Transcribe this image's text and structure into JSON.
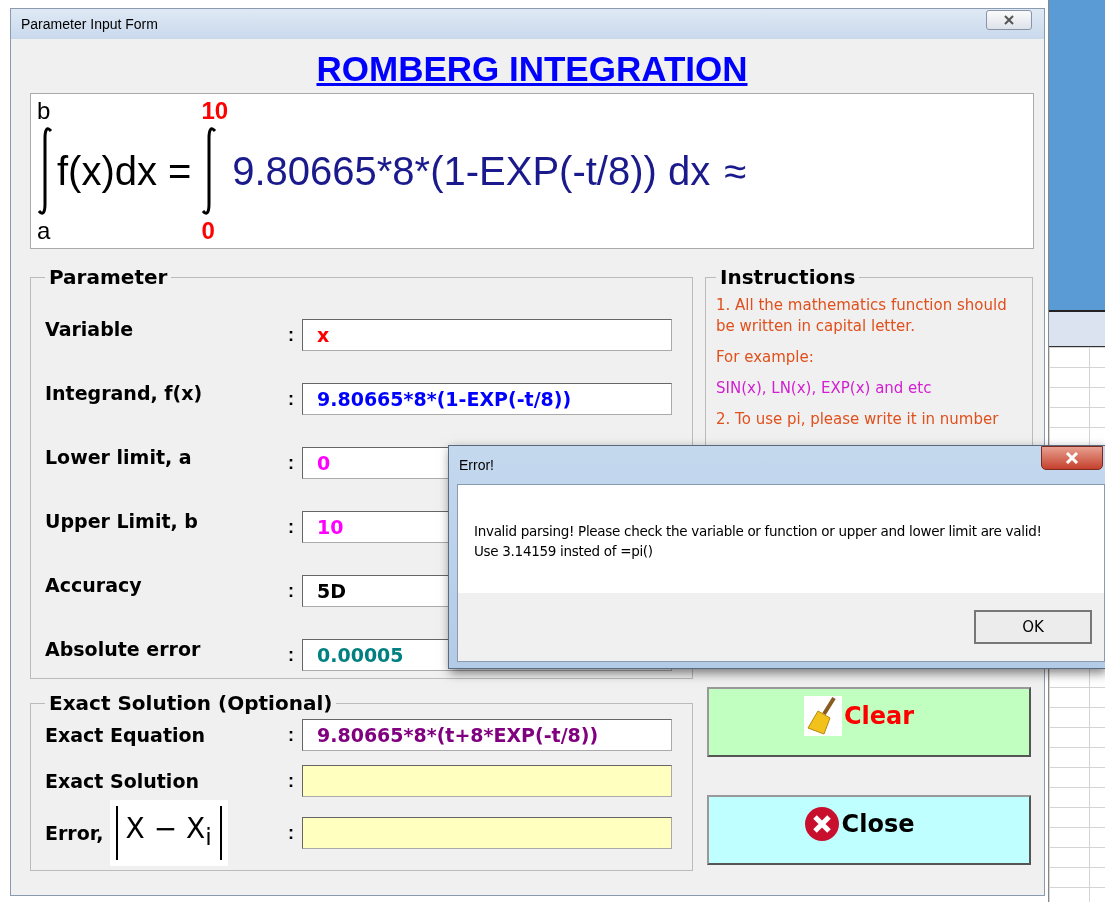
{
  "window": {
    "title": "Parameter Input Form"
  },
  "heading": "ROMBERG INTEGRATION",
  "formula": {
    "left_upper": "b",
    "left_lower": "a",
    "left_expr": "f(x)dx =",
    "upper": "10",
    "lower": "0",
    "integrand": "9.80665*8*(1-EXP(-t/8)) dx",
    "approx": "≈"
  },
  "parameter": {
    "title": "Parameter",
    "fields": [
      {
        "label": "Variable",
        "separator": ":",
        "value": "x",
        "color": "#ff0000"
      },
      {
        "label": "Integrand, f(x)",
        "separator": ":",
        "value": "9.80665*8*(1-EXP(-t/8))",
        "color": "#0000ff"
      },
      {
        "label": "Lower limit, a",
        "separator": ":",
        "value": "0",
        "color": "#ff00ff"
      },
      {
        "label": "Upper Limit, b",
        "separator": ":",
        "value": "10",
        "color": "#ff00ff"
      },
      {
        "label": "Accuracy",
        "separator": ":",
        "value": "5D",
        "color": "#000000"
      },
      {
        "label": "Absolute error",
        "separator": ":",
        "value": "0.00005",
        "color": "#008080"
      }
    ]
  },
  "instructions": {
    "title": "Instructions",
    "lines": [
      {
        "text": "1. All the mathematics function should be written in capital letter.",
        "color": "#e0501c"
      },
      {
        "text": "For example:",
        "color": "#e0501c"
      },
      {
        "text": "SIN(x), LN(x), EXP(x) and etc",
        "color": "#d21ed2"
      },
      {
        "text": "2. To use pi, please write it in number",
        "color": "#e0501c"
      }
    ]
  },
  "exact": {
    "title": "Exact Solution (Optional)",
    "fields": [
      {
        "label": "Exact Equation",
        "separator": ":",
        "value": "9.80665*8*(t+8*EXP(-t/8))",
        "kind": "input"
      },
      {
        "label": "Exact Solution",
        "separator": ":",
        "kind": "output"
      },
      {
        "label": "Error,",
        "formula": "X − X$_{i}$",
        "separator": ":",
        "kind": "output"
      }
    ]
  },
  "buttons": [
    {
      "label": "Clear",
      "kind": "clear"
    },
    {
      "label": "Close",
      "kind": "close"
    }
  ],
  "dialog": {
    "title": "Error!",
    "message": "Invalid parsing! Please check the variable or function or upper and lower limit are valid! Use 3.14159 insted of =pi()",
    "button": "OK"
  }
}
